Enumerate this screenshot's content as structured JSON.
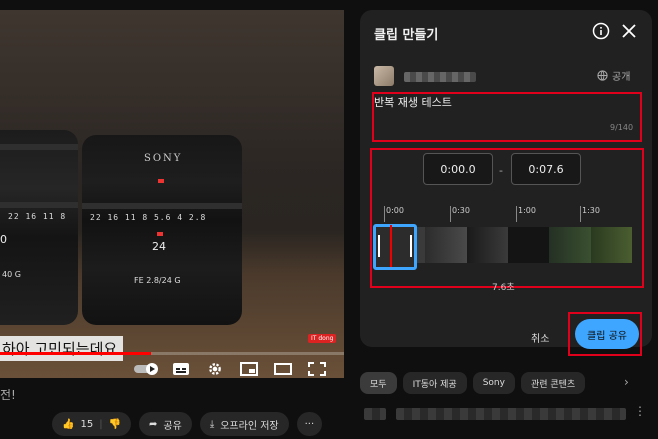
{
  "video": {
    "lens_left_ticks": "22 16 11 8",
    "lens_left_focal": "0",
    "lens_left_model": "40 G",
    "lens_right_brand": "SONY",
    "lens_right_ticks": "22 16 11 8 5.6 4 2.8",
    "lens_right_focal": "24",
    "lens_right_model": "FE 2.8/24 G",
    "caption": "하아 고민되는데요",
    "watermark": "IT dong",
    "progress_fraction": 0.44
  },
  "below_title": "전!",
  "actions": {
    "like_count": "15",
    "share_label": "공유",
    "offline_label": "오프라인 저장",
    "more_label": "···"
  },
  "panel": {
    "title": "클립 만들기",
    "info_icon": "info-icon",
    "close_icon": "close-icon",
    "visibility": "공개",
    "clip_title": "반복 재생 테스트",
    "counter": "9/140",
    "start_time": "0:00.0",
    "dash": "-",
    "end_time": "0:07.6",
    "timeline_ticks": [
      "0:00",
      "0:30",
      "1:00",
      "1:30"
    ],
    "duration": "7.6초",
    "cancel_label": "취소",
    "share_label": "클립 공유",
    "accent": "#3ea6ff",
    "highlight_border": "#e0001b"
  },
  "chips": [
    "모두",
    "IT동아 제공",
    "Sony",
    "관련 콘텐츠"
  ]
}
